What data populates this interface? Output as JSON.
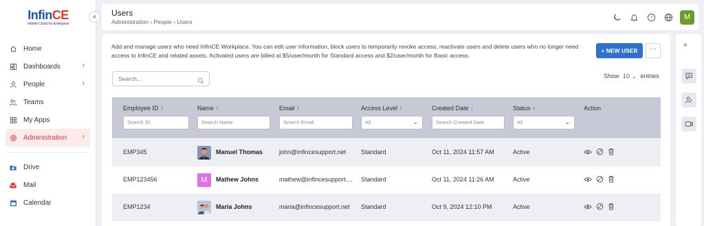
{
  "app": {
    "logo_main_a": "Inf",
    "logo_main_b": "in",
    "logo_main_c": "CE",
    "logo_tagline": "Infinite Cloud for Enterprise"
  },
  "sidebar": {
    "items": [
      {
        "label": "Home",
        "icon": "home-icon"
      },
      {
        "label": "Dashboards",
        "icon": "dashboard-icon"
      },
      {
        "label": "People",
        "icon": "person-icon"
      },
      {
        "label": "Teams",
        "icon": "teams-icon"
      },
      {
        "label": "My Apps",
        "icon": "apps-icon"
      },
      {
        "label": "Administration",
        "icon": "admin-icon",
        "active": true
      }
    ],
    "apps": [
      {
        "label": "Drive",
        "icon": "drive-icon"
      },
      {
        "label": "Mail",
        "icon": "mail-icon"
      },
      {
        "label": "Calendar",
        "icon": "calendar-icon"
      }
    ]
  },
  "header": {
    "title": "Users",
    "breadcrumb": [
      "Administration",
      "People",
      "Users"
    ],
    "avatar_initial": "M"
  },
  "main": {
    "description": "Add and manage users who need InfinCE Workplace. You can edit user information, block users to temporarily revoke access, reactivate users and delete users who no longer need access to InfinCE and related assets. Activated users are billed at  $5/user/month for Standard access and $2/user/month for Basic access.",
    "new_user_label": "+ NEW USER",
    "more_label": "···",
    "search_placeholder": "Search...",
    "show_label": "Show",
    "show_value": "10",
    "entries_label": "entries"
  },
  "table": {
    "columns": [
      {
        "label": "Employee ID",
        "filter": "Search ID"
      },
      {
        "label": "Name",
        "filter": "Search Name"
      },
      {
        "label": "Email",
        "filter": "Search Email"
      },
      {
        "label": "Access Level",
        "filter": "All"
      },
      {
        "label": "Created Date",
        "filter": "Search Created Date"
      },
      {
        "label": "Status",
        "filter": "All"
      },
      {
        "label": "Action",
        "filter": ""
      }
    ],
    "rows": [
      {
        "id": "EMP345",
        "name": "Manuel Thomas",
        "email": "john@infincesupport.net",
        "access": "Standard",
        "created": "Oct 11, 2024 11:57 AM",
        "status": "Active",
        "avatar": "photo"
      },
      {
        "id": "EMP123456",
        "name": "Mathew Johns",
        "email": "mathew@infincesupport....",
        "access": "Standard",
        "created": "Oct 11, 2024 11:26 AM",
        "status": "Active",
        "avatar": "M"
      },
      {
        "id": "EMP1234",
        "name": "Maria Johns",
        "email": "maria@infincesupport.net",
        "access": "Standard",
        "created": "Oct 9, 2024 12:10 PM",
        "status": "Active",
        "avatar": "photo"
      }
    ]
  },
  "colors": {
    "accent": "#2f6fcf",
    "active_nav": "#d93a3a",
    "avatar_green": "#6e9a2c",
    "avatar_pink": "#e070e8"
  }
}
